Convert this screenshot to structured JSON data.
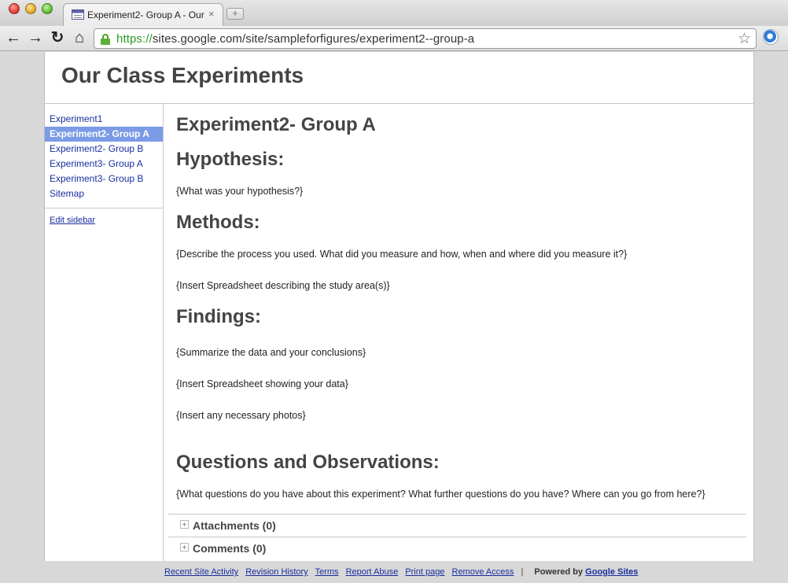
{
  "browser": {
    "tab": {
      "title": "Experiment2- Group A - Our",
      "close": "×",
      "new_tab": "+"
    },
    "toolbar": {
      "back": "←",
      "forward": "→",
      "reload": "↻",
      "home": "⌂",
      "url_scheme": "https://",
      "url_rest": "sites.google.com/site/sampleforfigures/experiment2--group-a",
      "star": "☆"
    }
  },
  "site": {
    "title": "Our Class Experiments"
  },
  "sidebar": {
    "items": [
      {
        "label": "Experiment1"
      },
      {
        "label": "Experiment2- Group A"
      },
      {
        "label": "Experiment2- Group B"
      },
      {
        "label": "Experiment3- Group A"
      },
      {
        "label": "Experiment3- Group B"
      },
      {
        "label": "Sitemap"
      }
    ],
    "current_index": 1,
    "edit_link": "Edit sidebar"
  },
  "main": {
    "page_title": "Experiment2- Group A",
    "hypothesis": {
      "heading": "Hypothesis:",
      "text": "{What was your hypothesis?}"
    },
    "methods": {
      "heading": "Methods:",
      "text1": "{Describe the process you used.  What did you measure and how, when and where did you measure it?}",
      "text2": "{Insert Spreadsheet describing the study area(s)}"
    },
    "findings": {
      "heading": "Findings:",
      "text1": "{Summarize the data and your conclusions}",
      "text2": "{Insert Spreadsheet showing your data}",
      "text3": "{Insert any necessary photos}"
    },
    "questions": {
      "heading": "Questions and Observations:",
      "text": "{What questions do you have about this experiment?  What further questions do you have?  Where can you go from here?}"
    },
    "attachments_label": "Attachments (0)",
    "comments_label": "Comments (0)"
  },
  "footer": {
    "recent_activity": "Recent Site Activity",
    "revision_history": "Revision History",
    "terms": "Terms",
    "report_abuse": "Report Abuse",
    "print_page": "Print page",
    "remove_access": "Remove Access",
    "separator": "|",
    "powered_by": "Powered by",
    "google_sites": "Google Sites"
  }
}
